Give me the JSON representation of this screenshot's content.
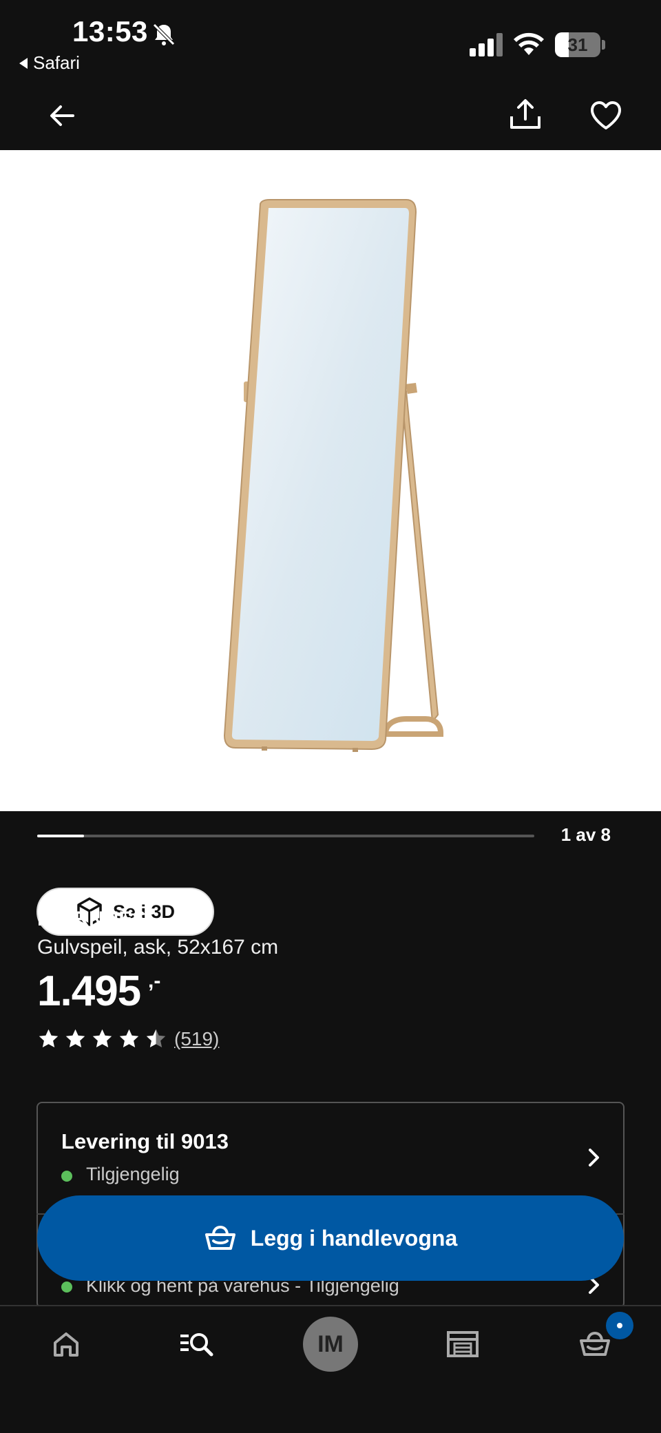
{
  "status_bar": {
    "time": "13:53",
    "back_app": "Safari",
    "battery_percent": "31",
    "battery_level": 0.31
  },
  "product": {
    "brand": "IKORNNES",
    "description": "Gulvspeil, ask, 52x167 cm",
    "price": "1.495",
    "price_suffix": ",-",
    "rating": 4.5,
    "reviews": "(519)",
    "view_3d_label": "Se i 3D",
    "image_counter": "1 av 8",
    "image_index": 1,
    "image_total": 8
  },
  "delivery": {
    "title": "Levering til 9013",
    "status": "Tilgjengelig",
    "click_collect": "Klikk og hent på varehus - Tilgjengelig"
  },
  "cta": {
    "add_to_cart": "Legg i handlevogna"
  },
  "bottom_nav": {
    "avatar_initials": "IM"
  },
  "colors": {
    "accent_blue": "#0058a3",
    "available_green": "#5cbf5c",
    "frame_wood": "#d9b98e"
  }
}
